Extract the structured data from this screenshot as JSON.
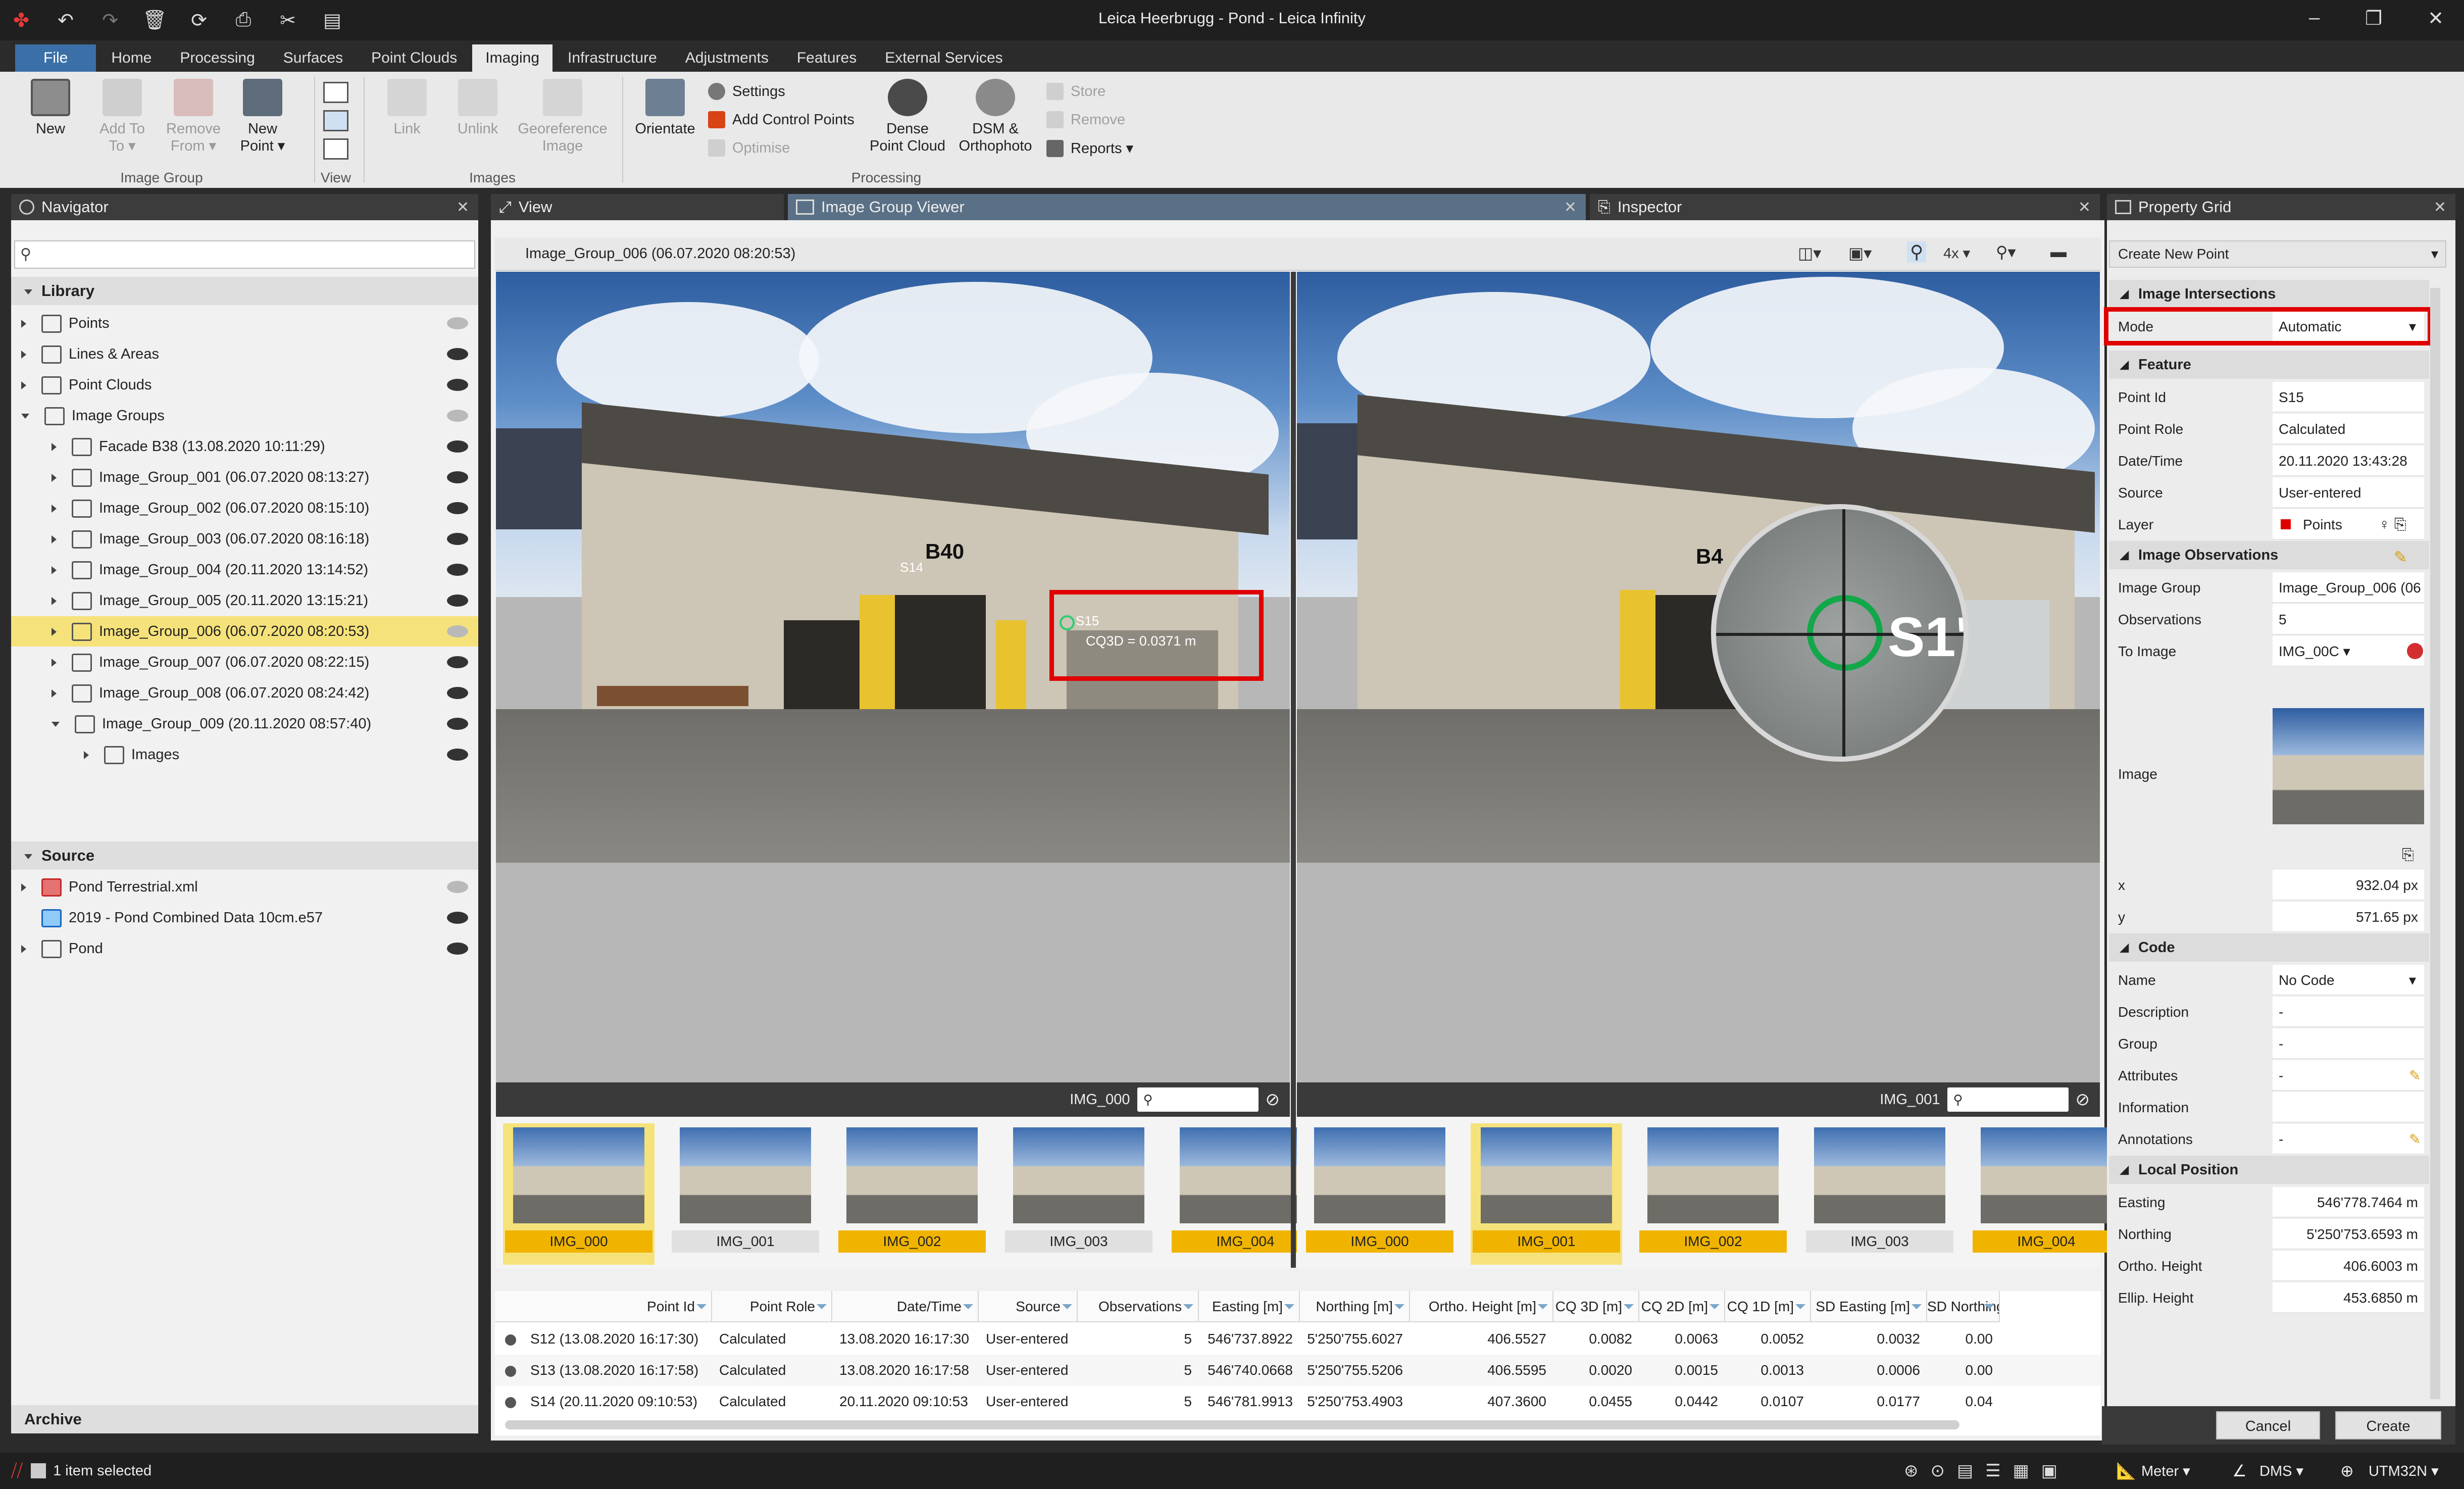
{
  "window": {
    "title": "Leica Heerbrugg - Pond - Leica Infinity"
  },
  "quick_access": [
    "app-logo",
    "undo-icon",
    "redo-icon",
    "delete-icon",
    "sync-icon",
    "refresh-icon",
    "save-icon",
    "tools-icon",
    "layout-icon"
  ],
  "menu_tabs": [
    "File",
    "Home",
    "Processing",
    "Surfaces",
    "Point Clouds",
    "Imaging",
    "Infrastructure",
    "Adjustments",
    "Features",
    "External Services"
  ],
  "active_tab": "Imaging",
  "ribbon": {
    "image_group": {
      "label": "Image Group",
      "new": "New",
      "add_to": "Add To",
      "add_to2": "To ▾",
      "remove_from": "Remove",
      "remove_from2": "From ▾",
      "new_point": "New",
      "new_point2": "Point ▾"
    },
    "view": {
      "label": "View"
    },
    "images": {
      "label": "Images",
      "link": "Link",
      "unlink": "Unlink",
      "georeference": "Georeference",
      "georeference2": "Image"
    },
    "processing": {
      "label": "Processing",
      "orientate": "Orientate",
      "settings": "Settings",
      "add_control_points": "Add Control Points",
      "optimise": "Optimise",
      "dense": "Dense",
      "dense2": "Point Cloud",
      "dsm": "DSM &",
      "dsm2": "Orthophoto",
      "store": "Store",
      "remove": "Remove",
      "reports": "Reports ▾"
    }
  },
  "navigator": {
    "title": "Navigator",
    "search_placeholder": "",
    "library_label": "Library",
    "library": [
      {
        "label": "Points",
        "eye": "dim"
      },
      {
        "label": "Lines & Areas",
        "eye": "on"
      },
      {
        "label": "Point Clouds",
        "eye": "on"
      },
      {
        "label": "Image Groups",
        "eye": "dim"
      },
      {
        "label": "Facade B38 (13.08.2020 10:11:29)",
        "eye": "on"
      },
      {
        "label": "Image_Group_001 (06.07.2020 08:13:27)",
        "eye": "on"
      },
      {
        "label": "Image_Group_002 (06.07.2020 08:15:10)",
        "eye": "on"
      },
      {
        "label": "Image_Group_003 (06.07.2020 08:16:18)",
        "eye": "on"
      },
      {
        "label": "Image_Group_004 (20.11.2020 13:14:52)",
        "eye": "on"
      },
      {
        "label": "Image_Group_005 (20.11.2020 13:15:21)",
        "eye": "on"
      },
      {
        "label": "Image_Group_006 (06.07.2020 08:20:53)",
        "eye": "dim"
      },
      {
        "label": "Image_Group_007 (06.07.2020 08:22:15)",
        "eye": "on"
      },
      {
        "label": "Image_Group_008 (06.07.2020 08:24:42)",
        "eye": "on"
      },
      {
        "label": "Image_Group_009 (20.11.2020 08:57:40)",
        "eye": "on"
      },
      {
        "label": "Images",
        "eye": "on"
      }
    ],
    "source_label": "Source",
    "source": [
      {
        "label": "Pond Terrestrial.xml",
        "eye": "dim"
      },
      {
        "label": "2019 - Pond Combined Data 10cm.e57",
        "eye": "on"
      },
      {
        "label": "Pond",
        "eye": "on"
      }
    ],
    "archive_label": "Archive"
  },
  "doc_tabs": {
    "view": "View",
    "viewer": "Image Group Viewer",
    "inspector": "Inspector"
  },
  "viewer": {
    "header": "Image_Group_006 (06.07.2020 08:20:53)",
    "zoom": "4x ▾",
    "left_image": "IMG_000",
    "right_image": "IMG_001",
    "building_label": "B40",
    "building_label_right": "B4",
    "point_label_small": "S14",
    "point_label": "S15",
    "cq_label": "CQ3D = 0.0371 m",
    "magnifier_label": "S1'",
    "highlight_color": "#e00000",
    "left_thumbs": [
      "IMG_000",
      "IMG_001",
      "IMG_002",
      "IMG_003",
      "IMG_004"
    ],
    "left_thumbs_state": [
      "sel",
      "plain",
      "yel",
      "plain",
      "yel"
    ],
    "right_thumbs": [
      "IMG_000",
      "IMG_001",
      "IMG_002",
      "IMG_003",
      "IMG_004"
    ],
    "right_thumbs_state": [
      "yel",
      "sel",
      "yel",
      "plain",
      "yel"
    ]
  },
  "table": {
    "columns": [
      "Point Id",
      "Point Role",
      "Date/Time",
      "Source",
      "Observations",
      "Easting [m]",
      "Northing [m]",
      "Ortho. Height [m]",
      "CQ 3D [m]",
      "CQ 2D [m]",
      "CQ 1D [m]",
      "SD Easting [m]",
      "SD Northing ["
    ],
    "rows": [
      [
        "S12 (13.08.2020 16:17:30)",
        "Calculated",
        "13.08.2020 16:17:30",
        "User-entered",
        "5",
        "546'737.8922",
        "5'250'755.6027",
        "406.5527",
        "0.0082",
        "0.0063",
        "0.0052",
        "0.0032",
        "0.00"
      ],
      [
        "S13 (13.08.2020 16:17:58)",
        "Calculated",
        "13.08.2020 16:17:58",
        "User-entered",
        "5",
        "546'740.0668",
        "5'250'755.5206",
        "406.5595",
        "0.0020",
        "0.0015",
        "0.0013",
        "0.0006",
        "0.00"
      ],
      [
        "S14 (20.11.2020 09:10:53)",
        "Calculated",
        "20.11.2020 09:10:53",
        "User-entered",
        "5",
        "546'781.9913",
        "5'250'753.4903",
        "407.3600",
        "0.0455",
        "0.0442",
        "0.0107",
        "0.0177",
        "0.04"
      ]
    ]
  },
  "property_grid": {
    "title": "Property Grid",
    "dropdown": "Create New Point",
    "sections": {
      "intersections": "Image Intersections",
      "feature": "Feature",
      "observations": "Image Observations",
      "code": "Code",
      "local_position": "Local Position"
    },
    "mode": {
      "key": "Mode",
      "value": "Automatic"
    },
    "feature": [
      {
        "k": "Point Id",
        "v": "S15"
      },
      {
        "k": "Point Role",
        "v": "Calculated"
      },
      {
        "k": "Date/Time",
        "v": "20.11.2020 13:43:28"
      },
      {
        "k": "Source",
        "v": "User-entered"
      },
      {
        "k": "Layer",
        "v": "Points"
      }
    ],
    "observations": [
      {
        "k": "Image Group",
        "v": "Image_Group_006 (06"
      },
      {
        "k": "Observations",
        "v": "5"
      },
      {
        "k": "To Image",
        "v": "IMG_00C ▾"
      }
    ],
    "image_key": "Image",
    "xy": [
      {
        "k": "x",
        "v": "932.04  px"
      },
      {
        "k": "y",
        "v": "571.65  px"
      }
    ],
    "code": [
      {
        "k": "Name",
        "v": "No Code"
      },
      {
        "k": "Description",
        "v": "-"
      },
      {
        "k": "Group",
        "v": "-"
      },
      {
        "k": "Attributes",
        "v": "-"
      },
      {
        "k": "Information",
        "v": ""
      },
      {
        "k": "Annotations",
        "v": "-"
      }
    ],
    "local": [
      {
        "k": "Easting",
        "v": "546'778.7464  m"
      },
      {
        "k": "Northing",
        "v": "5'250'753.6593  m"
      },
      {
        "k": "Ortho. Height",
        "v": "406.6003  m"
      },
      {
        "k": "Ellip. Height",
        "v": "453.6850  m"
      }
    ],
    "cancel": "Cancel",
    "create": "Create"
  },
  "status": {
    "selection": "1 item selected",
    "units": "Meter ▾",
    "angle": "DMS ▾",
    "crs": "UTM32N ▾"
  }
}
